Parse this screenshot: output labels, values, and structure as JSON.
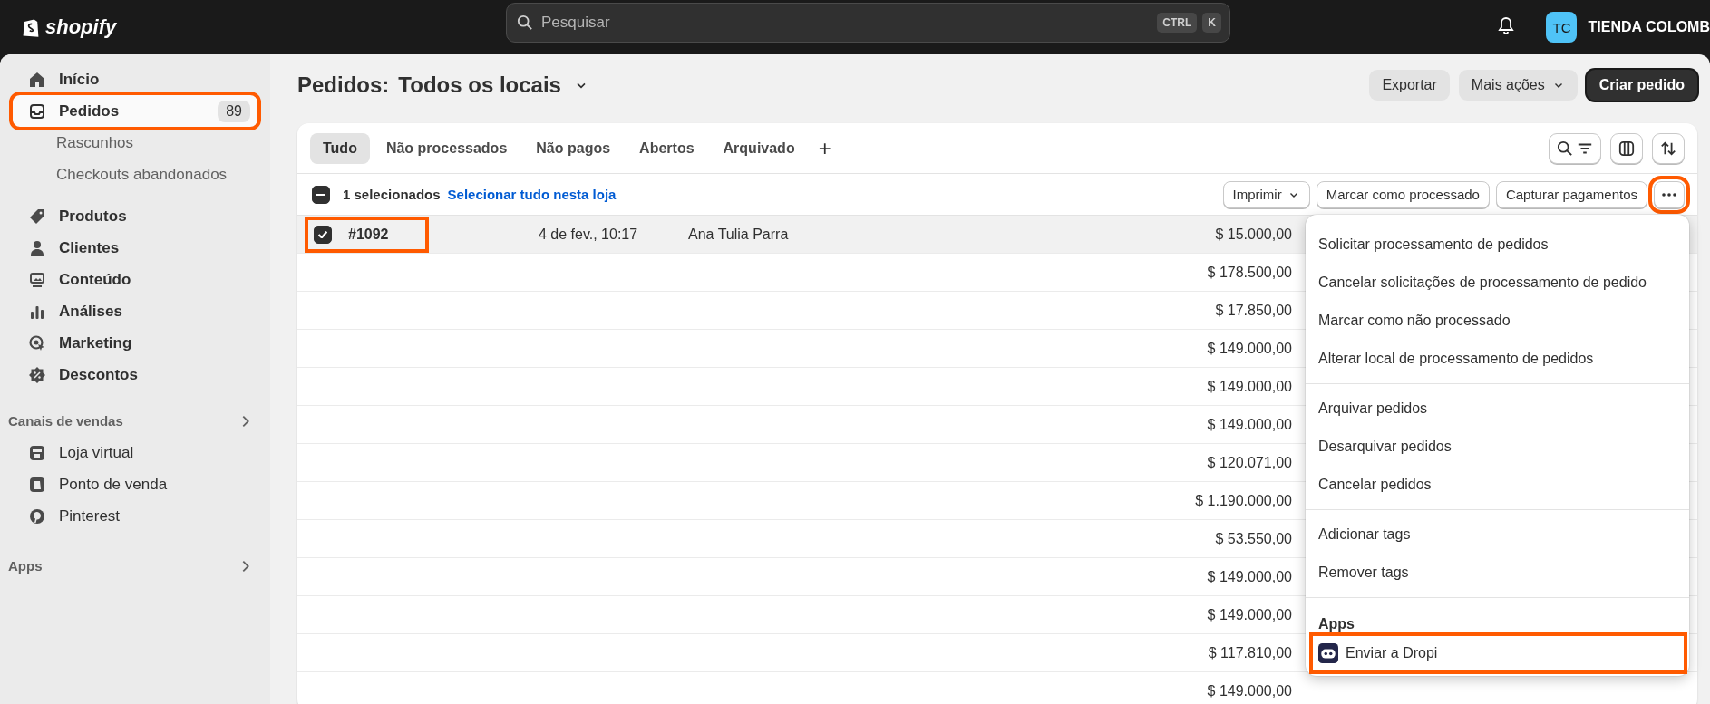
{
  "topbar": {
    "logo": "shopify",
    "search": {
      "placeholder": "Pesquisar"
    },
    "shortcut_keys": [
      "CTRL",
      "K"
    ],
    "store": {
      "initials": "TC",
      "name": "TIENDA COLOMB"
    }
  },
  "sidebar": {
    "items": [
      {
        "label": "Início",
        "selected": false,
        "highlighted": false
      },
      {
        "label": "Pedidos",
        "selected": true,
        "highlighted": true,
        "badge": "89",
        "children": [
          {
            "label": "Rascunhos",
            "selected": false
          },
          {
            "label": "Checkouts abandonados",
            "selected": false
          }
        ]
      },
      {
        "label": "Produtos",
        "selected": false,
        "highlighted": false
      },
      {
        "label": "Clientes",
        "selected": false,
        "highlighted": false
      },
      {
        "label": "Conteúdo",
        "selected": false,
        "highlighted": false
      },
      {
        "label": "Análises",
        "selected": false,
        "highlighted": false
      },
      {
        "label": "Marketing",
        "selected": false,
        "highlighted": false
      },
      {
        "label": "Descontos",
        "selected": false,
        "highlighted": false
      }
    ],
    "sections": [
      {
        "title": "Canais de vendas",
        "items": [
          {
            "label": "Loja virtual",
            "selected": false
          },
          {
            "label": "Ponto de venda",
            "selected": false
          },
          {
            "label": "Pinterest",
            "selected": false
          }
        ]
      },
      {
        "title": "Apps"
      }
    ]
  },
  "page": {
    "title": "Pedidos:",
    "location": "Todos os locais",
    "buttons": [
      {
        "label": "Exportar",
        "kind": "secondary"
      },
      {
        "label": "Mais ações",
        "kind": "dropdown"
      },
      {
        "label": "Criar pedido",
        "kind": "primary"
      }
    ]
  },
  "tabs": [
    {
      "label": "Tudo",
      "selected": true
    },
    {
      "label": "Não processados",
      "selected": false
    },
    {
      "label": "Não pagos",
      "selected": false
    },
    {
      "label": "Abertos",
      "selected": false
    },
    {
      "label": "Arquivado",
      "selected": false
    }
  ],
  "add_tab": "+",
  "bulk_bar": {
    "indeterminate": true,
    "selected_count": "1 selecionados",
    "select_all_link": "Selecionar tudo nesta loja",
    "actions": [
      {
        "label": "Imprimir",
        "kind": "dropdown"
      },
      {
        "label": "Marcar como processado",
        "kind": "plain"
      },
      {
        "label": "Capturar pagamentos",
        "kind": "plain"
      }
    ],
    "more_highlighted": true
  },
  "table": {
    "rows": [
      {
        "checked": true,
        "highlighted": true,
        "order": "#1092",
        "date": "4 de fev., 10:17",
        "customer": "Ana Tulia Parra",
        "total": "$ 15.000,00"
      },
      {
        "total": "$ 178.500,00"
      },
      {
        "total": "$ 17.850,00"
      },
      {
        "total": "$ 149.000,00"
      },
      {
        "total": "$ 149.000,00"
      },
      {
        "total": "$ 149.000,00"
      },
      {
        "total": "$ 120.071,00"
      },
      {
        "total": "$ 1.190.000,00"
      },
      {
        "total": "$ 53.550,00"
      },
      {
        "total": "$ 149.000,00"
      },
      {
        "total": "$ 149.000,00"
      },
      {
        "total": "$ 117.810,00"
      },
      {
        "total": "$ 149.000,00"
      }
    ]
  },
  "menu": {
    "sections": [
      {
        "items": [
          {
            "label": "Solicitar processamento de pedidos",
            "kind": "action",
            "highlighted": false
          },
          {
            "label": "Cancelar solicitações de processamento de pedido",
            "kind": "action",
            "highlighted": false
          },
          {
            "label": "Marcar como não processado",
            "kind": "action",
            "highlighted": false
          },
          {
            "label": "Alterar local de processamento de pedidos",
            "kind": "action",
            "highlighted": false
          }
        ]
      },
      {
        "items": [
          {
            "label": "Arquivar pedidos",
            "kind": "action",
            "highlighted": false
          },
          {
            "label": "Desarquivar pedidos",
            "kind": "action",
            "highlighted": false
          },
          {
            "label": "Cancelar pedidos",
            "kind": "action",
            "highlighted": false
          }
        ]
      },
      {
        "items": [
          {
            "label": "Adicionar tags",
            "kind": "action",
            "highlighted": false
          },
          {
            "label": "Remover tags",
            "kind": "action",
            "highlighted": false
          }
        ]
      },
      {
        "title": "Apps",
        "items": [
          {
            "label": "Enviar a Dropi",
            "kind": "app",
            "highlighted": true
          }
        ]
      }
    ]
  }
}
